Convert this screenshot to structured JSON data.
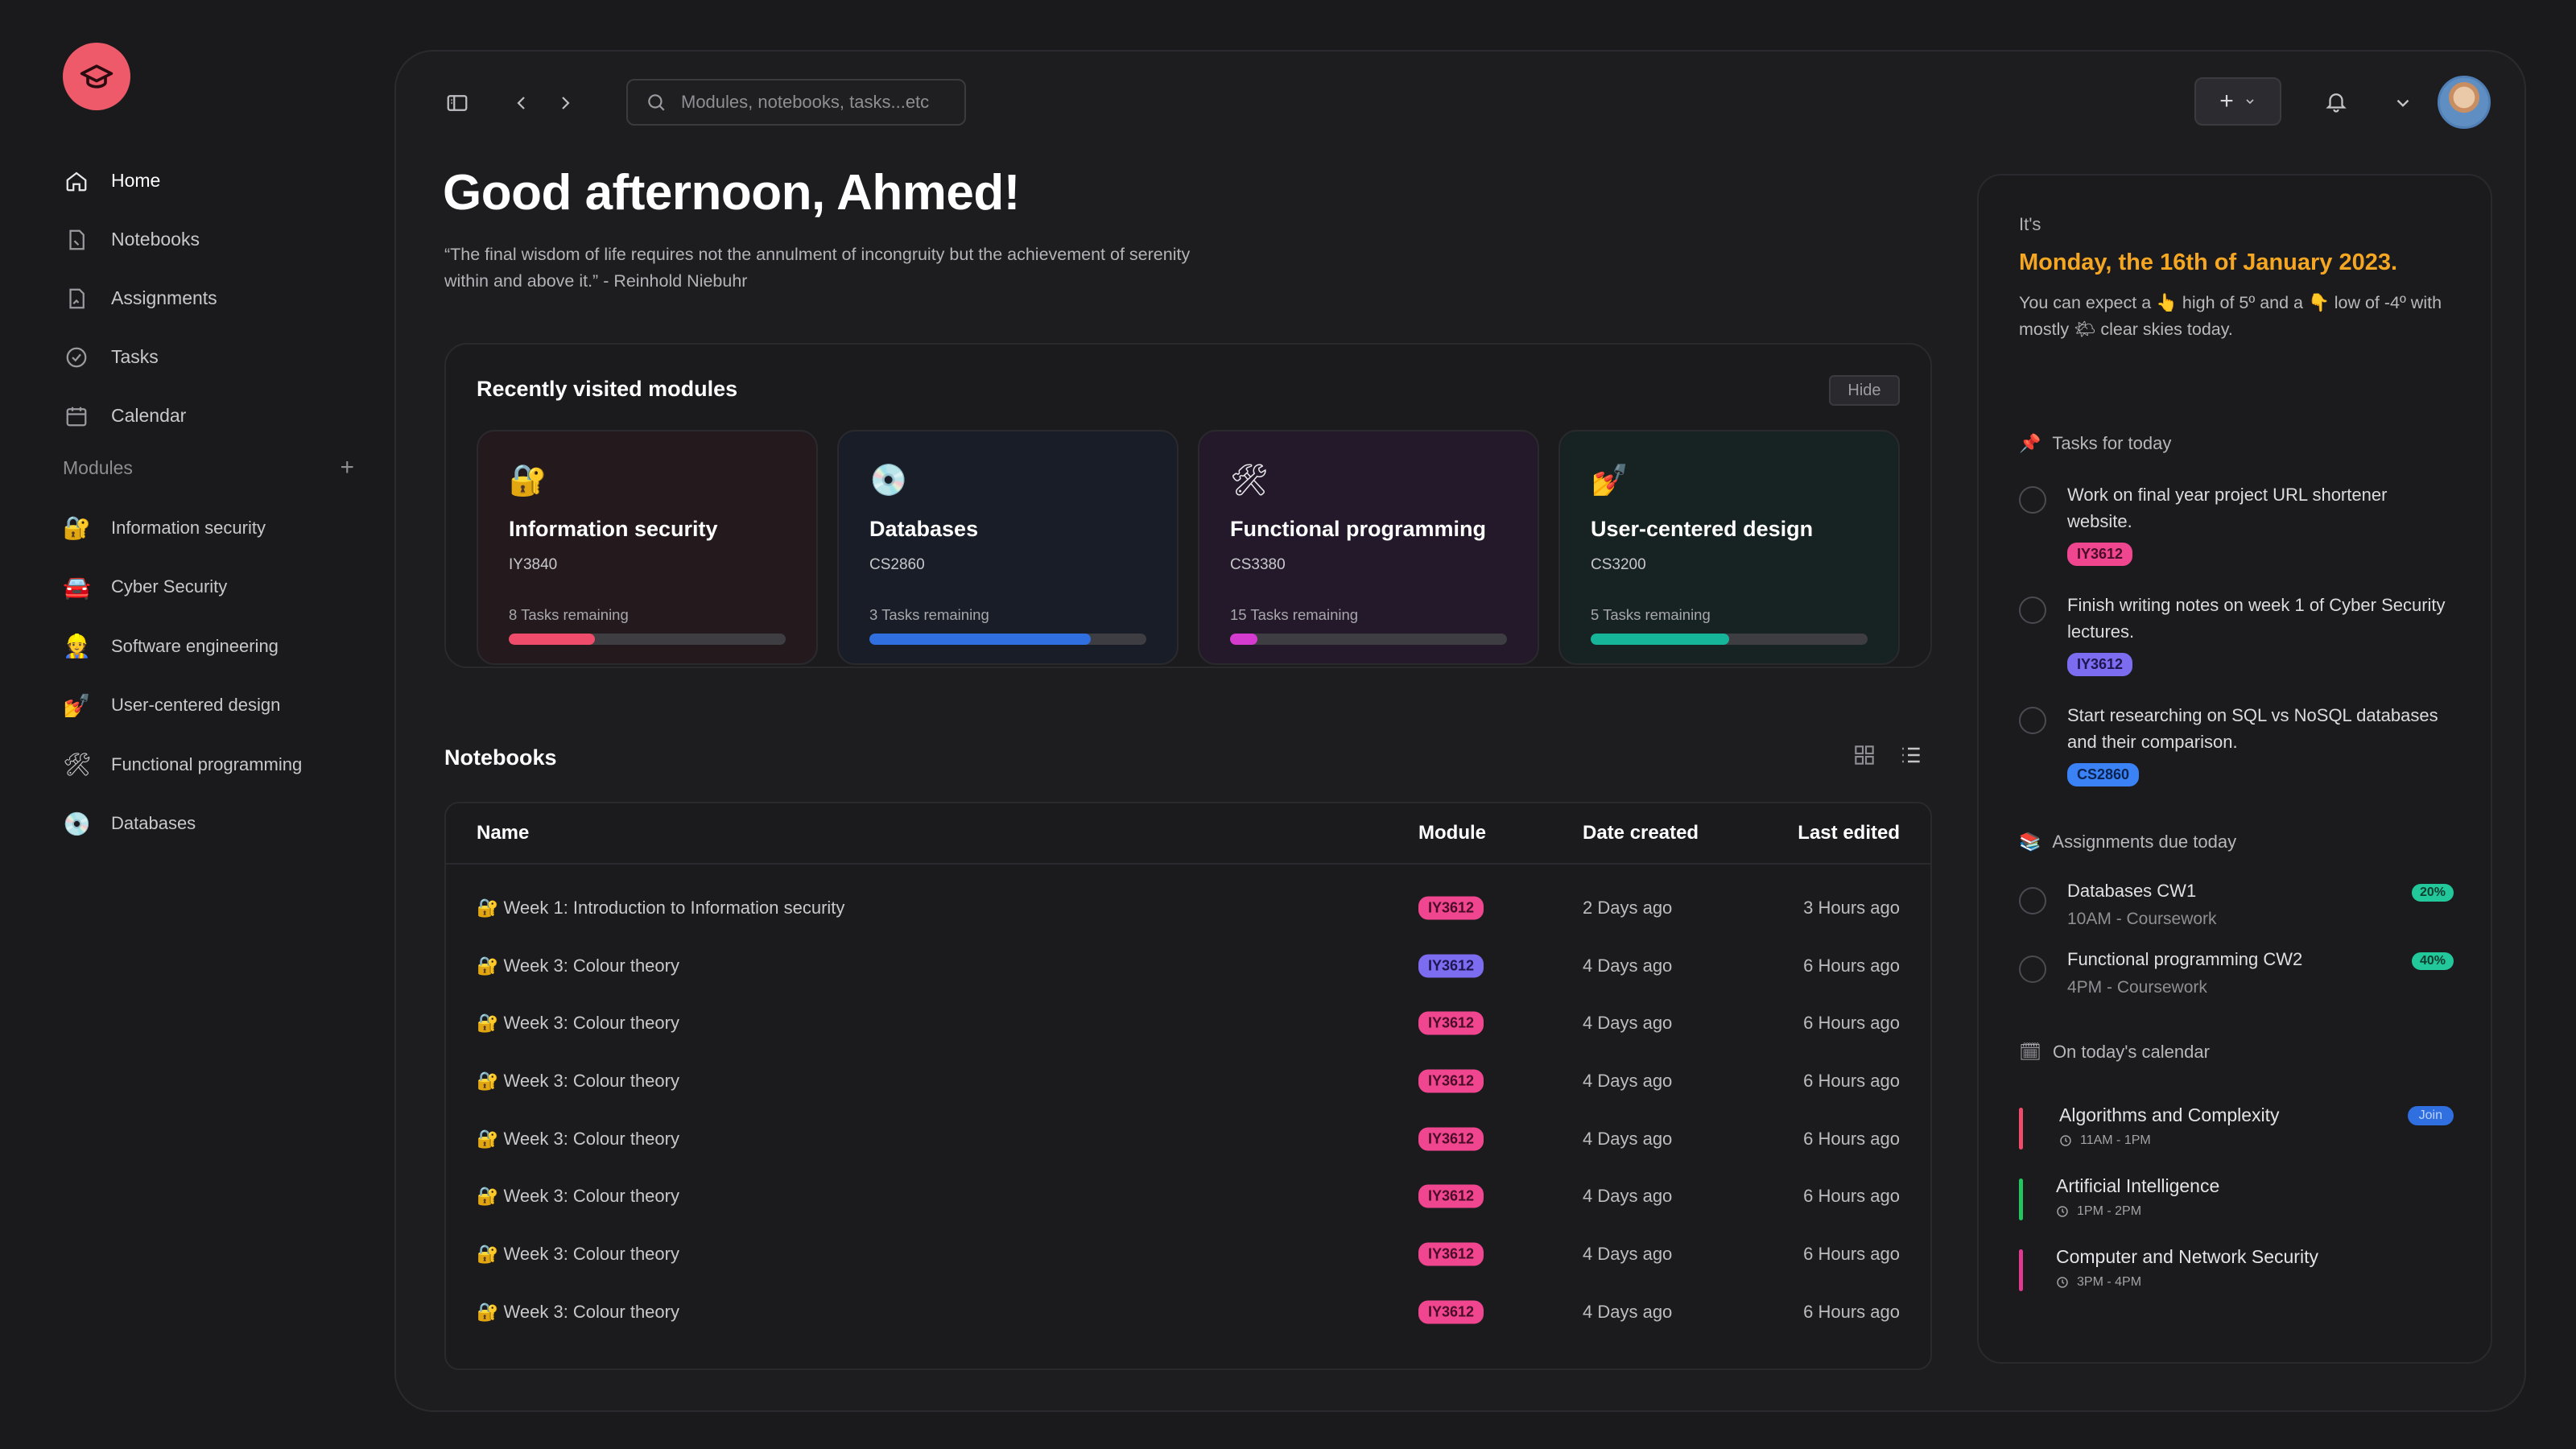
{
  "sidebar": {
    "nav": [
      {
        "label": "Home",
        "icon": "home-icon",
        "active": true
      },
      {
        "label": "Notebooks",
        "icon": "notebook-icon"
      },
      {
        "label": "Assignments",
        "icon": "assignment-icon"
      },
      {
        "label": "Tasks",
        "icon": "check-circle-icon"
      },
      {
        "label": "Calendar",
        "icon": "calendar-icon"
      }
    ],
    "modules_label": "Modules",
    "modules": [
      {
        "label": "Information security",
        "emoji": "🔐"
      },
      {
        "label": "Cyber Security",
        "emoji": "🚘"
      },
      {
        "label": "Software engineering",
        "emoji": "👷"
      },
      {
        "label": "User-centered design",
        "emoji": "💅"
      },
      {
        "label": "Functional programming",
        "emoji": "🛠"
      },
      {
        "label": "Databases",
        "emoji": "💿"
      }
    ]
  },
  "topbar": {
    "search_placeholder": "Modules, notebooks, tasks...etc",
    "add_label": "+"
  },
  "greeting": "Good afternoon, Ahmed!",
  "quote": "“The final wisdom of life requires not the annulment of incongruity but the achievement of serenity within and above it.” - Reinhold Niebuhr",
  "recent": {
    "title": "Recently visited modules",
    "hide_label": "Hide",
    "cards": [
      {
        "emoji": "🔐",
        "name": "Information security",
        "code": "IY3840",
        "remaining": "8 Tasks remaining",
        "progress": 0.31,
        "color": "#ef4b6b",
        "bg": "#241a1e"
      },
      {
        "emoji": "💿",
        "name": "Databases",
        "code": "CS2860",
        "remaining": "3 Tasks remaining",
        "progress": 0.8,
        "color": "#2f6fe0",
        "bg": "#181d27"
      },
      {
        "emoji": "🛠",
        "name": "Functional programming",
        "code": "CS3380",
        "remaining": "15 Tasks remaining",
        "progress": 0.1,
        "color": "#d63bd0",
        "bg": "#23192a"
      },
      {
        "emoji": "💅",
        "name": "User-centered design",
        "code": "CS3200",
        "remaining": "5 Tasks remaining",
        "progress": 0.5,
        "color": "#16b59a",
        "bg": "#172322"
      }
    ]
  },
  "notebooks": {
    "title": "Notebooks",
    "columns": {
      "name": "Name",
      "module": "Module",
      "date": "Date created",
      "edited": "Last edited"
    },
    "rows": [
      {
        "name": "🔐 Week 1: Introduction to Information security",
        "module": "IY3612",
        "pill": "pink",
        "date": "2 Days ago",
        "edited": "3 Hours ago"
      },
      {
        "name": "🔐 Week 3: Colour theory",
        "module": "IY3612",
        "pill": "purple",
        "date": "4 Days ago",
        "edited": "6 Hours ago"
      },
      {
        "name": "🔐 Week 3: Colour theory",
        "module": "IY3612",
        "pill": "pink",
        "date": "4 Days ago",
        "edited": "6 Hours ago"
      },
      {
        "name": "🔐 Week 3: Colour theory",
        "module": "IY3612",
        "pill": "pink",
        "date": "4 Days ago",
        "edited": "6 Hours ago"
      },
      {
        "name": "🔐 Week 3: Colour theory",
        "module": "IY3612",
        "pill": "pink",
        "date": "4 Days ago",
        "edited": "6 Hours ago"
      },
      {
        "name": "🔐 Week 3: Colour theory",
        "module": "IY3612",
        "pill": "pink",
        "date": "4 Days ago",
        "edited": "6 Hours ago"
      },
      {
        "name": "🔐 Week 3: Colour theory",
        "module": "IY3612",
        "pill": "pink",
        "date": "4 Days ago",
        "edited": "6 Hours ago"
      },
      {
        "name": "🔐 Week 3: Colour theory",
        "module": "IY3612",
        "pill": "pink",
        "date": "4 Days ago",
        "edited": "6 Hours ago"
      }
    ]
  },
  "right": {
    "its": "It's",
    "date": "Monday, the 16th of January 2023.",
    "weather": "You can expect a 👆 high of 5º and a 👇 low of -4º with mostly 🌤 clear skies today.",
    "tasks_title": "Tasks for today",
    "tasks_emoji": "📌",
    "tasks": [
      {
        "text": "Work on final year project URL shortener website.",
        "tag": "IY3612",
        "pill": "pink"
      },
      {
        "text": "Finish writing notes on week 1 of Cyber Security lectures.",
        "tag": "IY3612",
        "pill": "purple"
      },
      {
        "text": "Start researching on SQL vs NoSQL databases and their comparison.",
        "tag": "CS2860",
        "pill": "blue"
      }
    ],
    "assign_title": "Assignments due today",
    "assign_emoji": "📚",
    "assignments": [
      {
        "title": "Databases CW1",
        "sub": "10AM - Coursework",
        "pct": "20%"
      },
      {
        "title": "Functional programming CW2",
        "sub": "4PM - Coursework",
        "pct": "40%"
      }
    ],
    "cal_title": "On today's calendar",
    "cal_emoji": "🗓",
    "events": [
      {
        "title": "Algorithms and Complexity",
        "time": "11AM - 1PM",
        "color": "#ef4b6b",
        "join": "Join"
      },
      {
        "title": "Artificial Intelligence",
        "time": "1PM - 2PM",
        "color": "#22c55e"
      },
      {
        "title": "Computer and Network Security",
        "time": "3PM - 4PM",
        "color": "#e0398f"
      }
    ]
  },
  "colors": {
    "pink": "#f0468f",
    "purple": "#7c6cf0",
    "blue": "#3b82f6",
    "accent": "#f5a623"
  }
}
